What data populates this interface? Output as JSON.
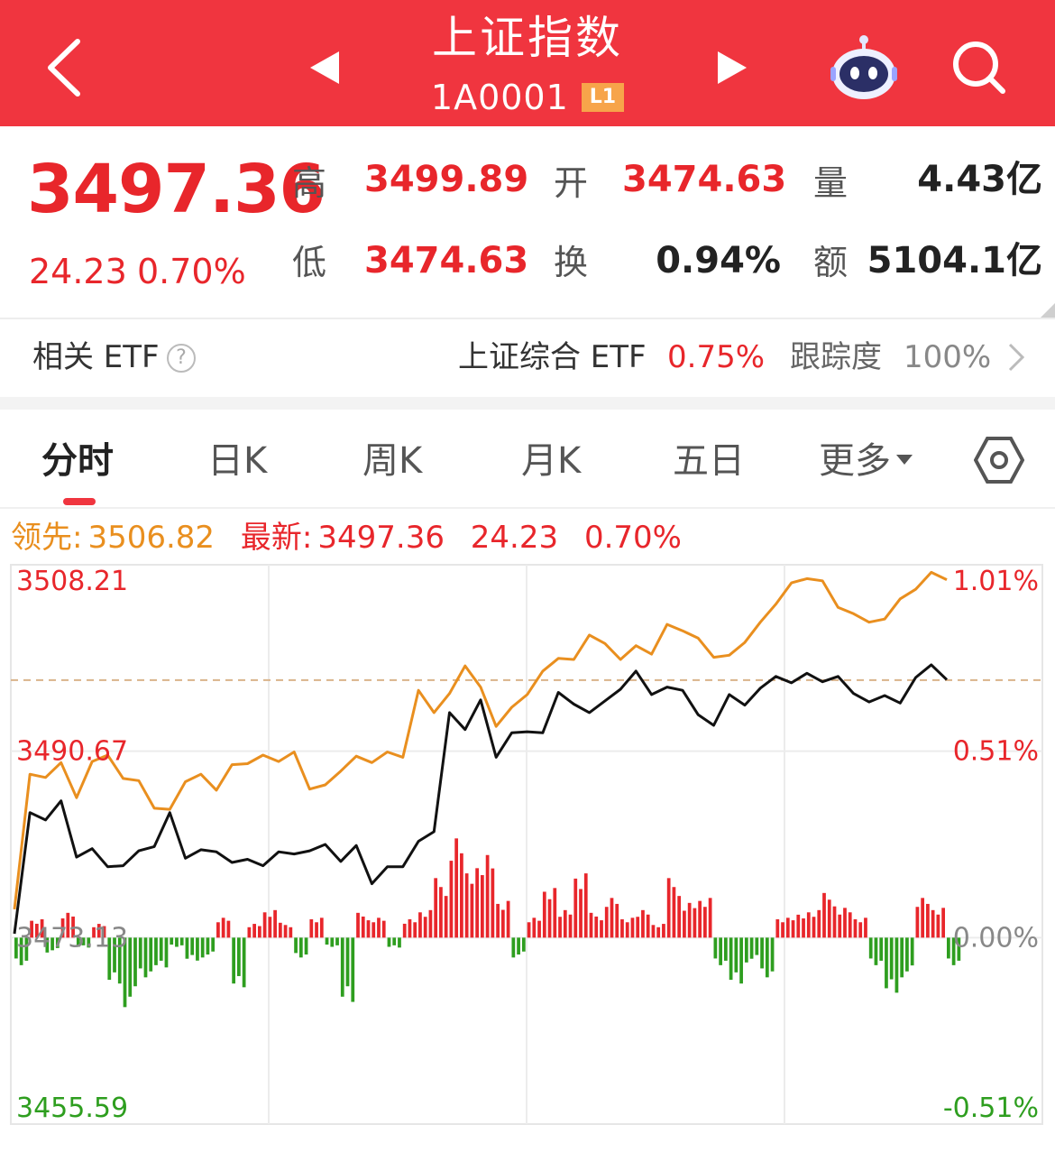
{
  "header": {
    "title": "上证指数",
    "code": "1A0001",
    "level_badge": "L1",
    "icons": {
      "back": "back-chevron-icon",
      "prev": "prev-triangle-icon",
      "next": "next-triangle-icon",
      "assistant": "robot-assistant-icon",
      "search": "search-icon"
    }
  },
  "quote": {
    "price": "3497.36",
    "change": "24.23",
    "change_pct": "0.70%",
    "high_label": "高",
    "high": "3499.89",
    "open_label": "开",
    "open": "3474.63",
    "volume_label": "量",
    "volume": "4.43亿",
    "low_label": "低",
    "low": "3474.63",
    "turnover_label": "换",
    "turnover": "0.94%",
    "amount_label": "额",
    "amount": "5104.1亿"
  },
  "etf": {
    "title": "相关 ETF",
    "help_icon": "?",
    "name": "上证综合 ETF",
    "pct": "0.75%",
    "tracking_label": "跟踪度",
    "tracking_value": "100%"
  },
  "tabs": [
    {
      "label": "分时",
      "active": true
    },
    {
      "label": "日K",
      "active": false
    },
    {
      "label": "周K",
      "active": false
    },
    {
      "label": "月K",
      "active": false
    },
    {
      "label": "五日",
      "active": false
    },
    {
      "label": "更多",
      "active": false
    }
  ],
  "info": {
    "lead_label": "领先:",
    "lead_value": "3506.82",
    "latest_label": "最新:",
    "latest_value": "3497.36",
    "latest_change": "24.23",
    "latest_pct": "0.70%"
  },
  "colors": {
    "brand_red": "#f0353f",
    "up_red": "#e8262b",
    "down_green": "#2e9e1f",
    "lead_orange": "#e98f1f",
    "price_black": "#111111"
  },
  "chart_data": {
    "type": "line",
    "title": "",
    "xlabel": "",
    "ylabel": "",
    "y_ticks_left": [
      "3508.21",
      "3490.67",
      "3473.13",
      "3455.59"
    ],
    "y_ticks_right": [
      "1.01%",
      "0.51%",
      "0.00%",
      "-0.51%"
    ],
    "ylim": [
      3455.59,
      3508.21
    ],
    "prev_close": 3473.13,
    "reference_line": 3497.36,
    "x": [
      0,
      4,
      8,
      12,
      16,
      20,
      24,
      28,
      32,
      36,
      40,
      44,
      48,
      52,
      56,
      60,
      64,
      68,
      72,
      76,
      80,
      84,
      88,
      92,
      96,
      100,
      104,
      108,
      112,
      116,
      120,
      124,
      128,
      132,
      136,
      140,
      144,
      148,
      152,
      156,
      160,
      164,
      168,
      172,
      176,
      180,
      184,
      188,
      192,
      196,
      200,
      204,
      208,
      212,
      216,
      220,
      224,
      228,
      232,
      236,
      240
    ],
    "series": [
      {
        "values": [
          3473.5,
          3484.9,
          3484.2,
          3486.0,
          3480.7,
          3481.5,
          3479.8,
          3479.9,
          3481.3,
          3481.7,
          3484.9,
          3480.6,
          3481.4,
          3481.2,
          3480.2,
          3480.5,
          3479.9,
          3481.2,
          3481.0,
          3481.3,
          3481.9,
          3480.3,
          3481.8,
          3478.2,
          3479.8,
          3479.8,
          3482.2,
          3483.1,
          3494.3,
          3492.7,
          3495.5,
          3490.1,
          3492.4,
          3492.5,
          3492.4,
          3496.2,
          3495.1,
          3494.3,
          3495.4,
          3496.5,
          3498.2,
          3496.0,
          3496.7,
          3496.4,
          3494.1,
          3493.1,
          3496.0,
          3495.0,
          3496.6,
          3497.7,
          3497.1,
          3498.0,
          3497.2,
          3497.7,
          3496.1,
          3495.3,
          3495.9,
          3495.2,
          3497.6,
          3498.8,
          3497.4
        ]
      },
      {
        "values": [
          3475.8,
          3488.5,
          3488.2,
          3489.6,
          3486.3,
          3489.7,
          3490.3,
          3488.1,
          3487.9,
          3485.3,
          3485.2,
          3487.8,
          3488.5,
          3487.0,
          3489.4,
          3489.5,
          3490.3,
          3489.7,
          3490.6,
          3487.1,
          3487.5,
          3488.8,
          3490.2,
          3489.6,
          3490.6,
          3490.1,
          3496.4,
          3494.3,
          3496.1,
          3498.7,
          3496.7,
          3493.0,
          3494.8,
          3496.0,
          3498.2,
          3499.4,
          3499.3,
          3501.6,
          3500.8,
          3499.3,
          3500.6,
          3499.8,
          3502.6,
          3502.0,
          3501.3,
          3499.5,
          3499.7,
          3500.9,
          3502.8,
          3504.5,
          3506.5,
          3506.9,
          3506.7,
          3504.2,
          3503.6,
          3502.8,
          3503.1,
          3505.0,
          3505.9,
          3507.5,
          3506.8
        ]
      },
      {
        "name": "",
        "values": [
          -6,
          4,
          -3,
          5,
          -2,
          3,
          -10,
          -14,
          -8,
          -6,
          -2,
          -5,
          -4,
          4,
          -10,
          3,
          6,
          3,
          -4,
          4,
          -2,
          -14,
          5,
          4,
          -2,
          4,
          6,
          12,
          20,
          14,
          18,
          8,
          -4,
          4,
          10,
          6,
          14,
          5,
          8,
          4,
          6,
          3,
          12,
          7,
          8,
          -6,
          -10,
          -5,
          -8,
          4,
          5,
          6,
          9,
          6,
          4,
          -6,
          -12,
          -8,
          8,
          6,
          -6
        ],
        "style": "volume-bars"
      }
    ]
  }
}
